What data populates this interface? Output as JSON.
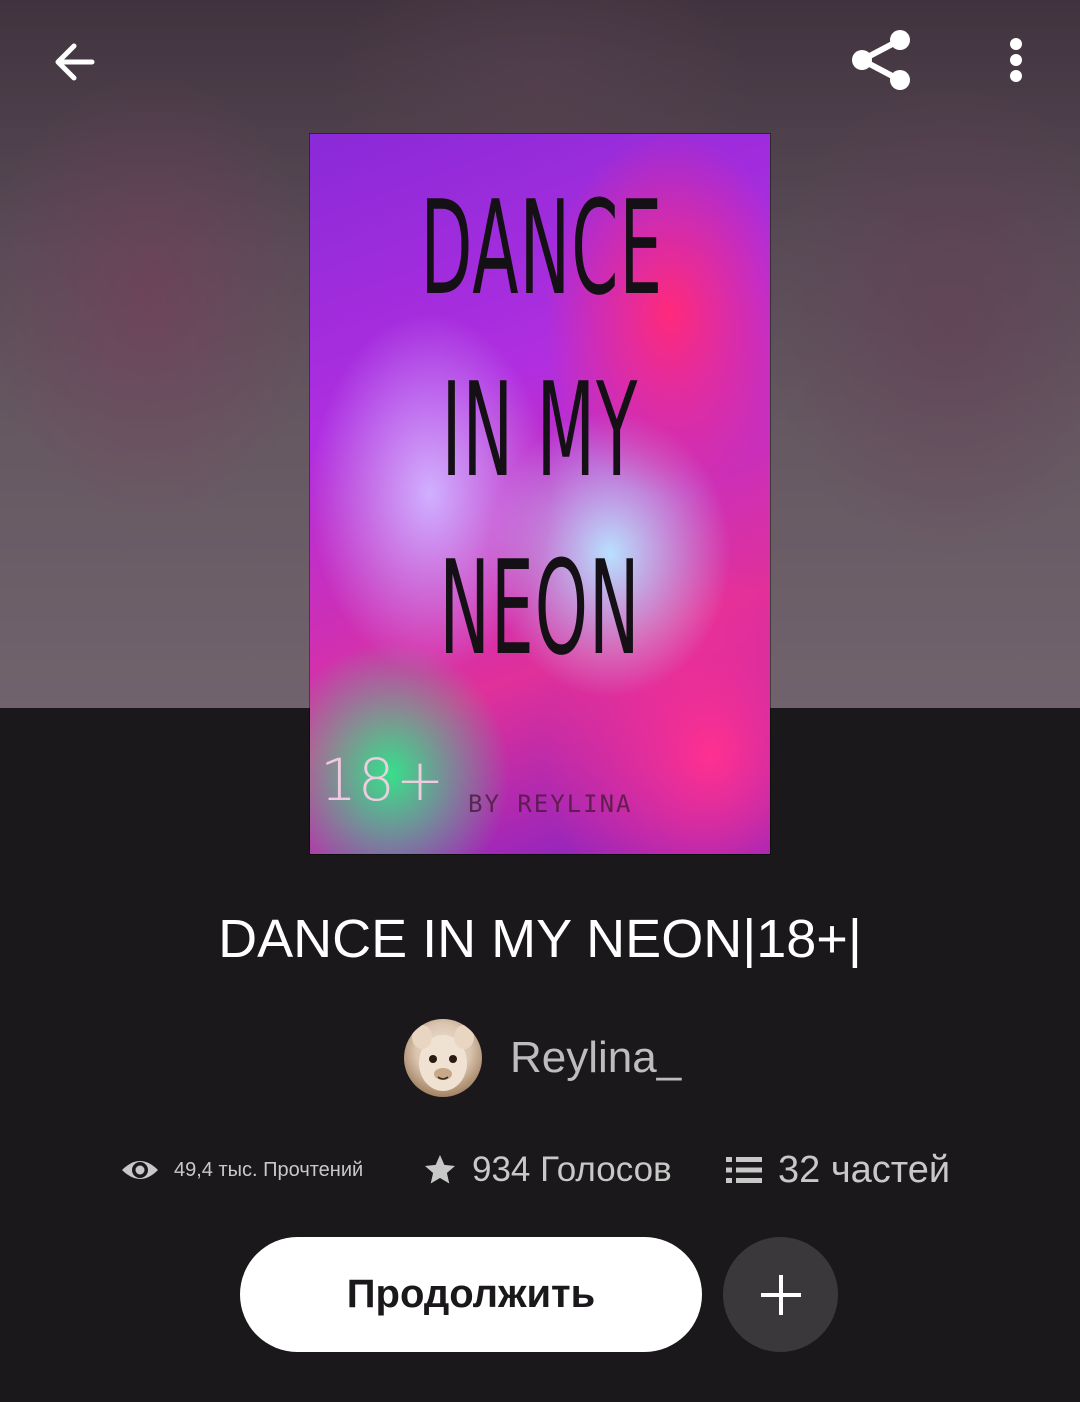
{
  "header": {
    "back_icon": "arrow-left-icon",
    "share_icon": "share-icon",
    "more_icon": "more-vertical-icon"
  },
  "cover": {
    "title_lines": [
      "DANCE",
      "IN MY",
      "NEON"
    ],
    "age_badge": "18+",
    "byline": "BY REYLINA"
  },
  "story": {
    "title": "DANCE IN MY NEON|18+|",
    "author": "Reylina_"
  },
  "stats": {
    "reads": "49,4 тыс. Прочтений",
    "votes": "934 Голосов",
    "parts": "32 частей"
  },
  "actions": {
    "continue_label": "Продолжить"
  },
  "colors": {
    "background": "#1a181a",
    "primary_button": "#ffffff",
    "secondary_button": "#3a383a",
    "muted_text": "#c8c8c8"
  }
}
